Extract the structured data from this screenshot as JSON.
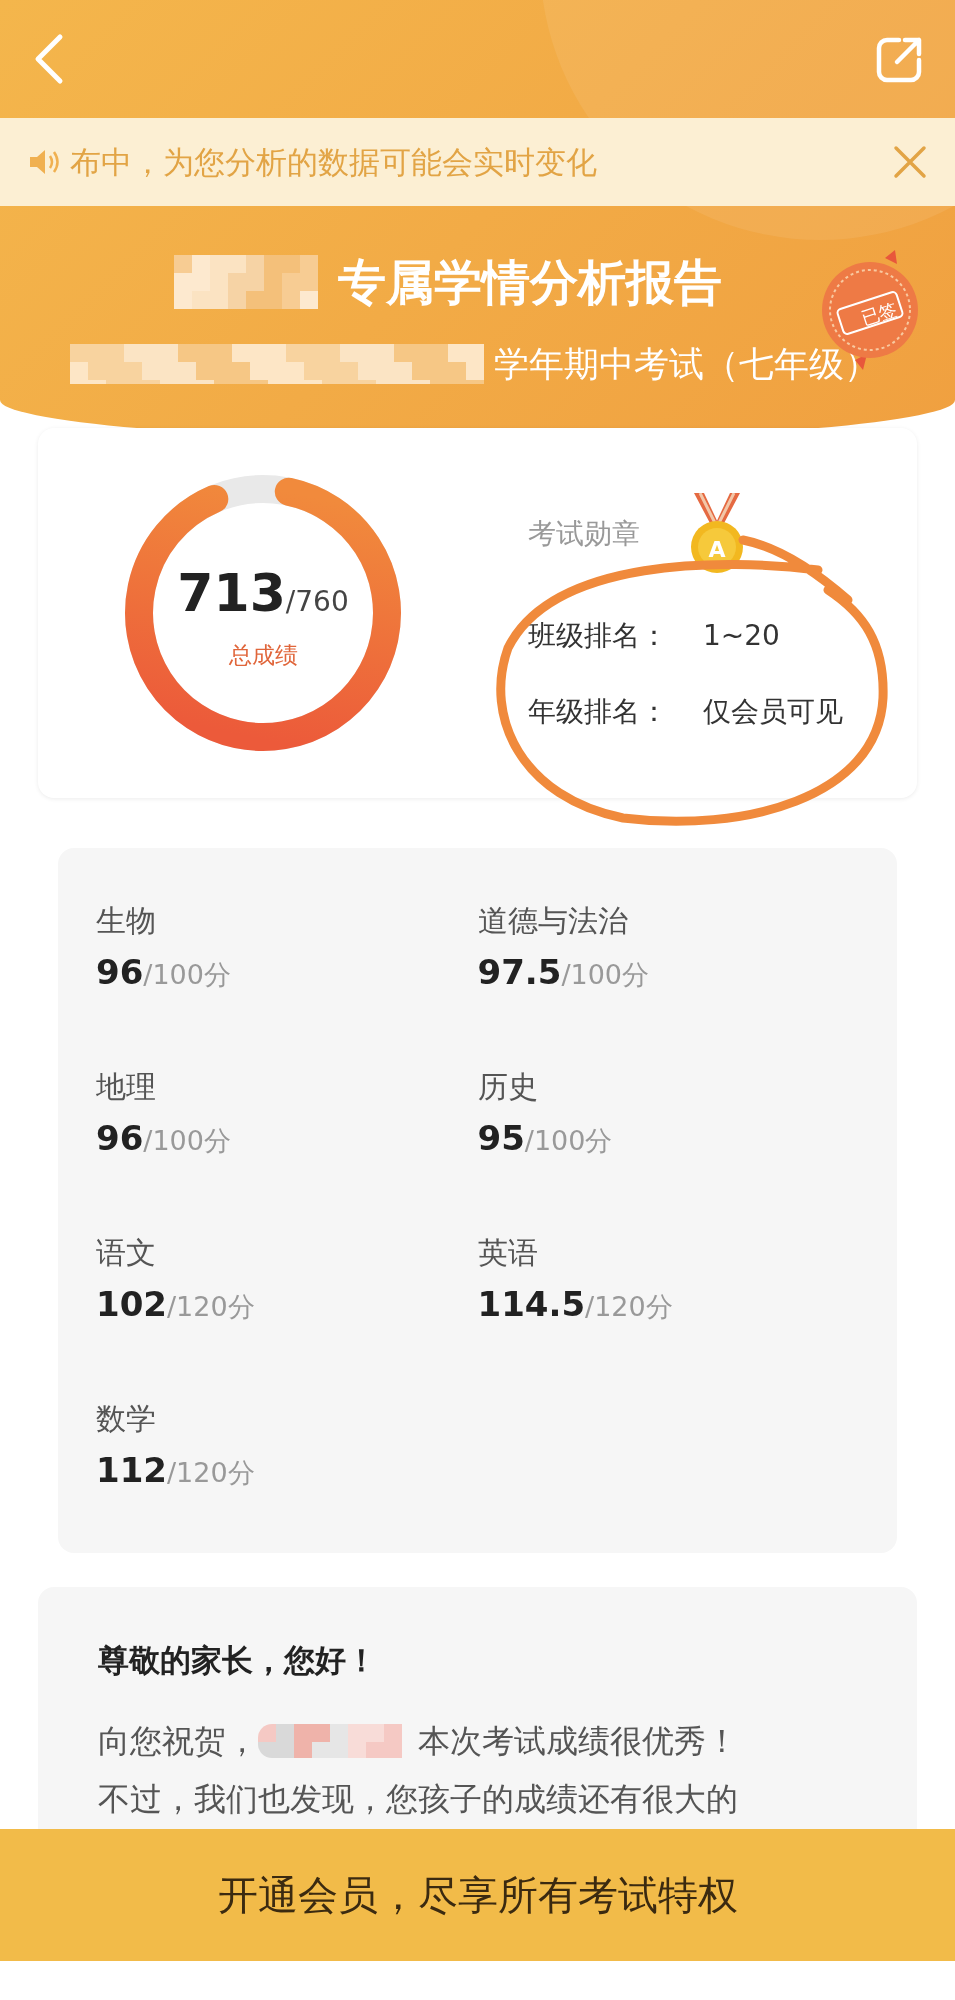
{
  "header": {
    "notice": "布中，为您分析的数据可能会实时变化",
    "title": "专属学情分析报告",
    "subtitle": "学年期中考试（七年级）",
    "stamp": "已签"
  },
  "summary": {
    "score": "713",
    "total": "/760",
    "label": "总成绩",
    "level": 0.938,
    "medal_label": "考试勋章",
    "medal_letter": "A",
    "rankings": [
      {
        "label": "班级排名：",
        "value": "1~20"
      },
      {
        "label": "年级排名：",
        "value": "仅会员可见"
      }
    ]
  },
  "subjects": [
    {
      "name": "生物",
      "score": "96",
      "total": "/100分"
    },
    {
      "name": "道德与法治",
      "score": "97.5",
      "total": "/100分"
    },
    {
      "name": "地理",
      "score": "96",
      "total": "/100分"
    },
    {
      "name": "历史",
      "score": "95",
      "total": "/100分"
    },
    {
      "name": "语文",
      "score": "102",
      "total": "/120分"
    },
    {
      "name": "英语",
      "score": "114.5",
      "total": "/120分"
    },
    {
      "name": "数学",
      "score": "112",
      "total": "/120分"
    }
  ],
  "letter": {
    "greeting": "尊敬的家长，您好！",
    "lines": [
      "向您祝贺，",
      "本次考试成绩很优秀！",
      "不过，我们也发现，您孩子的成绩还有很大的"
    ]
  },
  "cta": "开通会员，尽享所有考试特权"
}
